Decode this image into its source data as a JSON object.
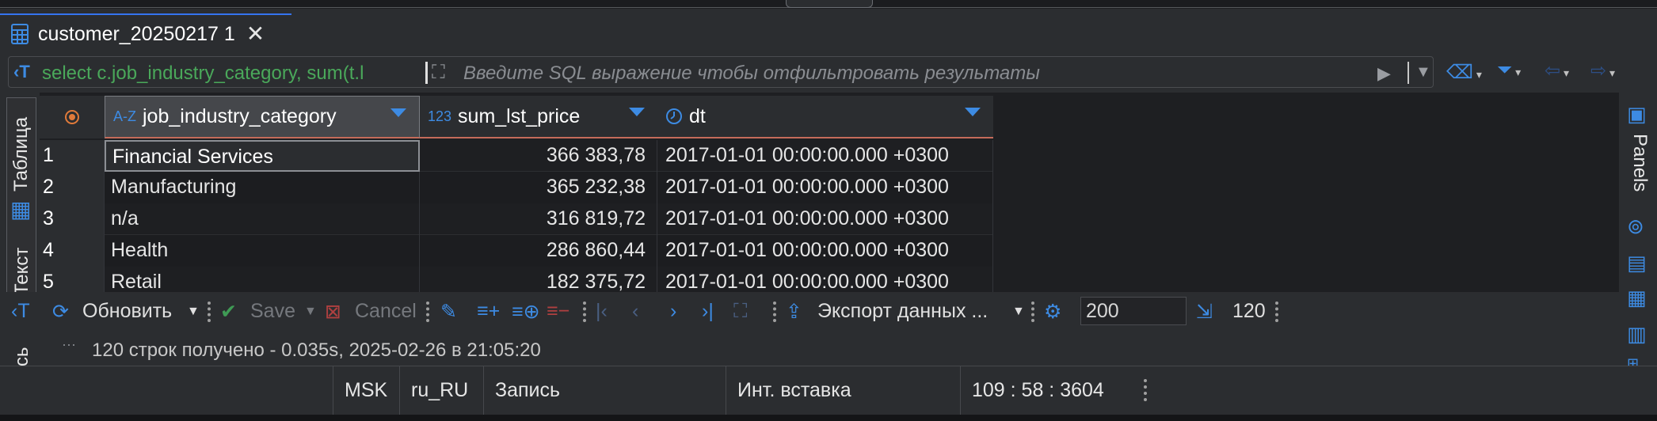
{
  "tab": {
    "title": "customer_20250217 1",
    "close": "✕"
  },
  "filter": {
    "sql": "select c.job_industry_category, sum(t.l",
    "placeholder": "Введите SQL выражение чтобы отфильтровать результаты"
  },
  "left_tabs": {
    "table": "Таблица",
    "text": "Текст",
    "extra": "сь"
  },
  "right_panel": {
    "label": "Panels"
  },
  "columns": [
    {
      "type": "A-Z",
      "name": "job_industry_category"
    },
    {
      "type": "123",
      "name": "sum_lst_price"
    },
    {
      "type": "clock",
      "name": "dt"
    }
  ],
  "rows": [
    {
      "n": "1",
      "category": "Financial Services",
      "sum": "366 383,78",
      "dt": "2017-01-01 00:00:00.000 +0300"
    },
    {
      "n": "2",
      "category": "Manufacturing",
      "sum": "365 232,38",
      "dt": "2017-01-01 00:00:00.000 +0300"
    },
    {
      "n": "3",
      "category": "n/a",
      "sum": "316 819,72",
      "dt": "2017-01-01 00:00:00.000 +0300"
    },
    {
      "n": "4",
      "category": "Health",
      "sum": "286 860,44",
      "dt": "2017-01-01 00:00:00.000 +0300"
    },
    {
      "n": "5",
      "category": "Retail",
      "sum": "182 375,72",
      "dt": "2017-01-01 00:00:00.000 +0300"
    }
  ],
  "toolbar": {
    "refresh": "Обновить",
    "save": "Save",
    "cancel": "Cancel",
    "export": "Экспорт данных ...",
    "fetch_size": "200",
    "row_count": "120"
  },
  "status": {
    "message": "120 строк получено - 0.035s, 2025-02-26 в 21:05:20",
    "ellipsis": "···"
  },
  "statusbar": {
    "timezone": "MSK",
    "locale": "ru_RU",
    "mode": "Запись",
    "insert": "Инт. вставка",
    "position": "109 : 58 : 3604"
  },
  "colors": {
    "accent": "#3d8be3",
    "sql_text": "#4aa85a",
    "header_underline": "#c56b5a",
    "background": "#1e1f22"
  }
}
